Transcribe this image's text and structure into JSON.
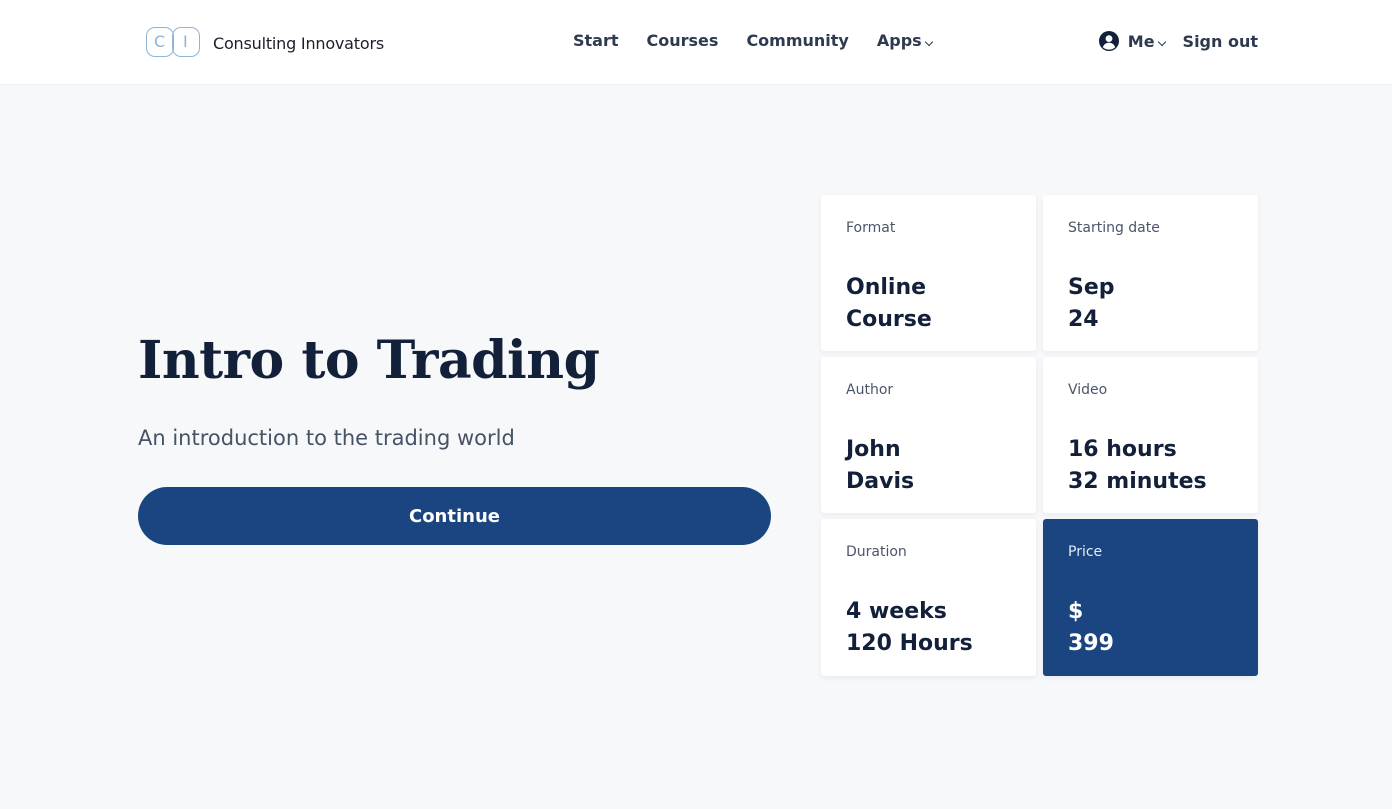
{
  "brand": {
    "logo_letters": [
      "C",
      "I"
    ],
    "name": "Consulting Innovators"
  },
  "nav": {
    "items": [
      {
        "label": "Start"
      },
      {
        "label": "Courses"
      },
      {
        "label": "Community"
      },
      {
        "label": "Apps",
        "has_dropdown": true
      }
    ]
  },
  "user": {
    "icon": "user-circle-icon",
    "me_label": "Me",
    "signout_label": "Sign out"
  },
  "course": {
    "title": "Intro to Trading",
    "subtitle": "An introduction to the trading world",
    "continue_label": "Continue"
  },
  "details": [
    {
      "label": "Format",
      "value": "Online\nCourse"
    },
    {
      "label": "Starting date",
      "value": "Sep\n24"
    },
    {
      "label": "Author",
      "value": "John\nDavis"
    },
    {
      "label": "Video",
      "value": "16 hours\n32 minutes"
    },
    {
      "label": "Duration",
      "value": "4 weeks\n120 Hours"
    },
    {
      "label": "Price",
      "value": "$\n399",
      "highlight": true
    }
  ],
  "colors": {
    "primary": "#1b4580",
    "background": "#f7f8fa",
    "logo_outline": "#8fb4d6",
    "text_dark": "#13203a"
  }
}
